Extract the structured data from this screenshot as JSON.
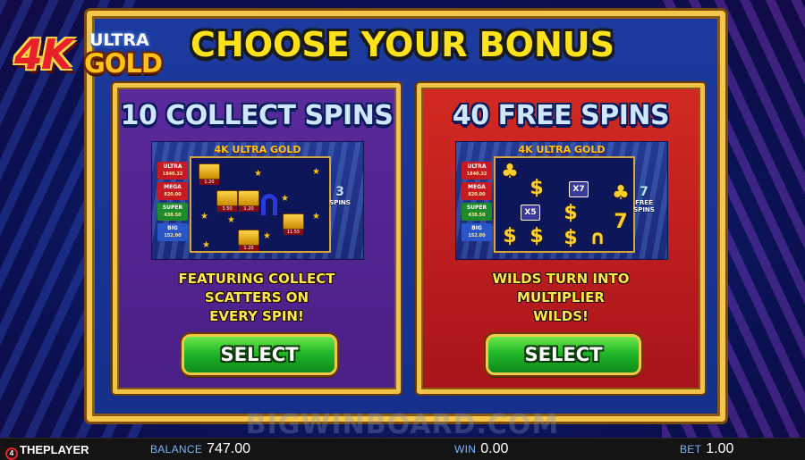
{
  "logo": {
    "prefix": "4K",
    "line1": "ULTRA",
    "line2": "GOLD"
  },
  "title": "CHOOSE YOUR BONUS",
  "options": [
    {
      "title": "10 COLLECT SPINS",
      "description_lines": [
        "FEATURING COLLECT",
        "SCATTERS ON",
        "EVERY SPIN!"
      ],
      "button_label": "SELECT",
      "preview": {
        "logo": "4K ULTRA GOLD",
        "counter_value": "3",
        "counter_label": "SPINS",
        "ladder": [
          {
            "name": "ULTRA",
            "value": "1840.32"
          },
          {
            "name": "MEGA",
            "value": "820.00"
          },
          {
            "name": "SUPER",
            "value": "438.50"
          },
          {
            "name": "BIG",
            "value": "152.00"
          }
        ],
        "block_values": [
          "1.20",
          "3.50",
          "1.20",
          "11.55",
          "1.20"
        ]
      }
    },
    {
      "title": "40 FREE SPINS",
      "description_lines": [
        "WILDS TURN INTO",
        "MULTIPLIER",
        "WILDS!"
      ],
      "button_label": "SELECT",
      "preview": {
        "logo": "4K ULTRA GOLD",
        "counter_value": "7",
        "counter_label": "FREE SPINS",
        "ladder": [
          {
            "name": "ULTRA",
            "value": "1840.32"
          },
          {
            "name": "MEGA",
            "value": "820.00"
          },
          {
            "name": "SUPER",
            "value": "438.50"
          },
          {
            "name": "BIG",
            "value": "152.00"
          }
        ],
        "multipliers": [
          "X7",
          "X5"
        ]
      }
    }
  ],
  "watermark": "BIGWINBOARD.COM",
  "footer": {
    "brand": "THEPLAYER",
    "brand_icon_text": "4",
    "balance_label": "BALANCE",
    "balance_value": "747.00",
    "win_label": "WIN",
    "win_value": "0.00",
    "bet_label": "BET",
    "bet_value": "1.00"
  },
  "colors": {
    "frame_gold": "#f4c64a",
    "title_yellow": "#ffe31a",
    "left_panel": "#4a1f86",
    "right_panel": "#a8141a",
    "button_green": "#22b82a"
  }
}
